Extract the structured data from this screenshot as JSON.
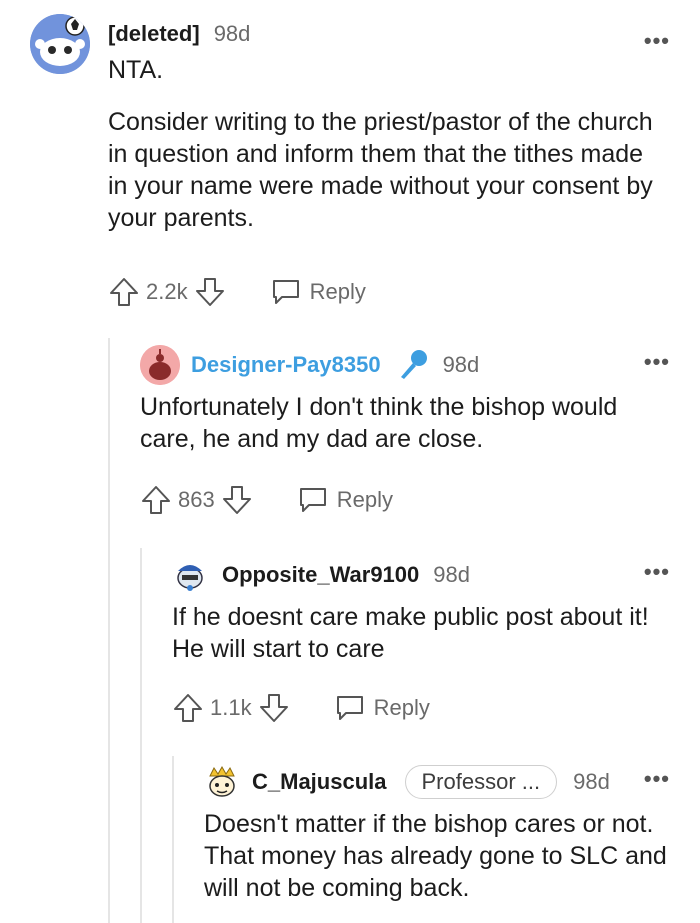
{
  "comments": [
    {
      "author": "[deleted]",
      "age": "98d",
      "more": "•••",
      "paragraphs": [
        "NTA.",
        "Consider writing to the priest/pastor of the church in question and inform them that the tithes made in your name were made without your consent by your parents."
      ],
      "score": "2.2k",
      "reply_label": "Reply",
      "avatar_icon": "snoo-avatar-icon"
    },
    {
      "author": "Designer-Pay8350",
      "age": "98d",
      "more": "•••",
      "badge_icon": "microphone-icon",
      "paragraphs": [
        "Unfortunately I don't think the bishop would care, he and my dad are close."
      ],
      "score": "863",
      "reply_label": "Reply",
      "avatar_icon": "snoo-avatar-icon",
      "accent": "#3d9ee0"
    },
    {
      "author": "Opposite_War9100",
      "age": "98d",
      "more": "•••",
      "paragraphs": [
        "If he doesnt care make public post about it! He will start to care"
      ],
      "score": "1.1k",
      "reply_label": "Reply",
      "avatar_icon": "snoo-avatar-icon"
    },
    {
      "author": "C_Majuscula",
      "flair": "Professor ...",
      "age": "98d",
      "more": "•••",
      "paragraphs": [
        "Doesn't matter if the bishop cares or not. That money has already gone to SLC and will not be coming back."
      ],
      "avatar_icon": "snoo-avatar-icon"
    }
  ]
}
